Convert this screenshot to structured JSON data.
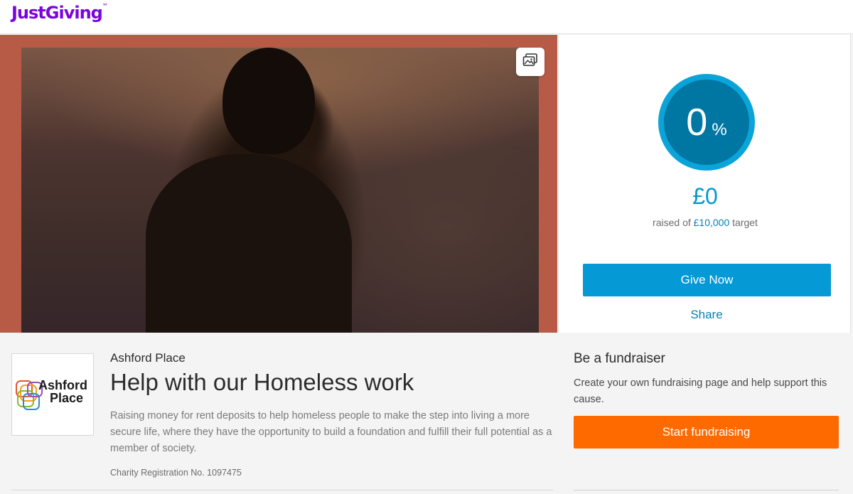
{
  "header": {
    "logo_text": "JustGiving",
    "logo_mark": "™"
  },
  "hero": {
    "gallery_icon": "image-gallery-icon"
  },
  "progress": {
    "percent": "0",
    "percent_sign": "%",
    "raised": "£0",
    "raised_prefix": "raised of",
    "target": "£10,000",
    "raised_suffix": "target",
    "give_label": "Give Now",
    "share_label": "Share"
  },
  "charity": {
    "logo_line1": "Ashford",
    "logo_line2": "Place",
    "name": "Ashford Place",
    "title": "Help with our Homeless work",
    "description": "Raising money for rent deposits to help homeless people to make the step into living a more secure life, where they have the opportunity to build a foundation and fulfill their full potential as a member of society.",
    "registration": "Charity Registration No. 1097475"
  },
  "fundraiser": {
    "title": "Be a fundraiser",
    "description": "Create your own fundraising page and help support this cause.",
    "button_label": "Start fundraising"
  },
  "colors": {
    "brand": "#7a04dd",
    "primary": "#0599d6",
    "accent": "#ff6a00",
    "hero_border": "#b85b46"
  }
}
